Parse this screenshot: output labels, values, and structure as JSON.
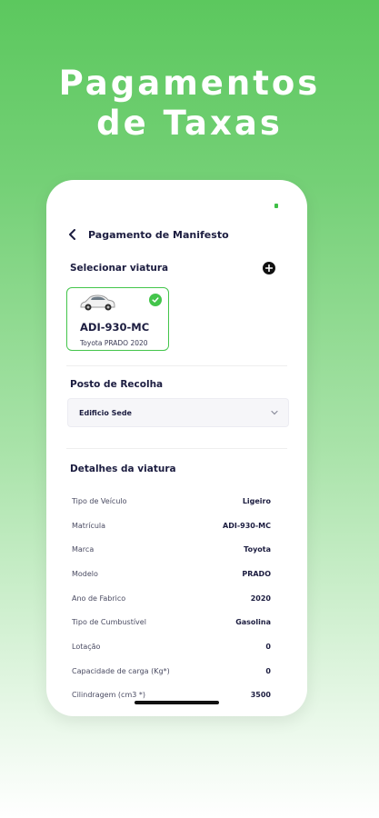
{
  "hero": {
    "line1": "Pagamentos",
    "line2": "de Taxas"
  },
  "header": {
    "title": "Pagamento de Manifesto",
    "back_icon": "arrow-left-icon"
  },
  "vehicle_section": {
    "title": "Selecionar viatura",
    "add_icon": "plus-circle-icon",
    "selected_vehicle": {
      "plate": "ADI-930-MC",
      "model": "Toyota PRADO 2020",
      "selected": true
    }
  },
  "posto_section": {
    "title": "Posto de Recolha",
    "selected_value": "Edificio Sede"
  },
  "details_section": {
    "title": "Detalhes da viatura",
    "rows": [
      {
        "label": "Tipo de Veículo",
        "value": "Ligeiro"
      },
      {
        "label": "Matrícula",
        "value": "ADI-930-MC"
      },
      {
        "label": "Marca",
        "value": "Toyota"
      },
      {
        "label": "Modelo",
        "value": "PRADO"
      },
      {
        "label": "Ano de Fabrico",
        "value": "2020"
      },
      {
        "label": "Tipo de Cumbustível",
        "value": "Gasolina"
      },
      {
        "label": "Lotação",
        "value": "0"
      },
      {
        "label": "Capacidade de carga (Kg*)",
        "value": "0"
      },
      {
        "label": "Cilindragem (cm3 *)",
        "value": "3500"
      }
    ]
  },
  "colors": {
    "accent": "#43c54b",
    "text_dark": "#1c1d40",
    "background_top": "#5cc85e"
  }
}
